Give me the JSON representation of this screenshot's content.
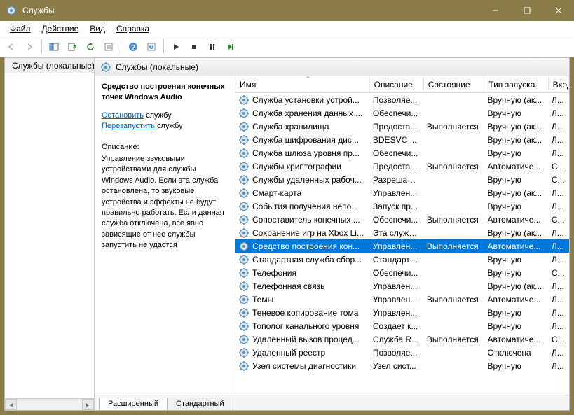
{
  "window": {
    "title": "Службы"
  },
  "menu": {
    "file": "Файл",
    "action": "Действие",
    "view": "Вид",
    "help": "Справка"
  },
  "tree": {
    "root": "Службы (локальные)"
  },
  "pane": {
    "header": "Службы (локальные)"
  },
  "detail": {
    "title": "Средство построения конечных точек Windows Audio",
    "stop_text": "Остановить",
    "stop_suffix": " службу",
    "restart_text": "Перезапустить",
    "restart_suffix": " службу",
    "desc_label": "Описание:",
    "desc": "Управление звуковыми устройствами для службы Windows Audio.  Если эта служба остановлена, то звуковые устройства и эффекты не будут правильно работать.  Если данная служба отключена, все явно зависящие от нее службы запустить не удастся"
  },
  "columns": {
    "name": "Имя",
    "desc": "Описание",
    "status": "Состояние",
    "startup": "Тип запуска",
    "logon": "Вход от имени"
  },
  "col_widths": {
    "name": 200,
    "desc": 80,
    "status": 90,
    "startup": 95,
    "logon": 30
  },
  "rows": [
    {
      "name": "Служба установки устрой...",
      "desc": "Позволяе...",
      "status": "",
      "startup": "Вручную (ак...",
      "logon": "Л..."
    },
    {
      "name": "Служба хранения данных ...",
      "desc": "Обеспечи...",
      "status": "",
      "startup": "Вручную",
      "logon": "Л..."
    },
    {
      "name": "Служба хранилища",
      "desc": "Предоста...",
      "status": "Выполняется",
      "startup": "Вручную (ак...",
      "logon": "Л..."
    },
    {
      "name": "Служба шифрования дис...",
      "desc": "BDESVC ...",
      "status": "",
      "startup": "Вручную (ак...",
      "logon": "Л..."
    },
    {
      "name": "Служба шлюза уровня пр...",
      "desc": "Обеспечи...",
      "status": "",
      "startup": "Вручную",
      "logon": "Л..."
    },
    {
      "name": "Службы криптографии",
      "desc": "Предоста...",
      "status": "Выполняется",
      "startup": "Автоматиче...",
      "logon": "С..."
    },
    {
      "name": "Службы удаленных рабоч...",
      "desc": "Разрешает...",
      "status": "",
      "startup": "Вручную",
      "logon": "С..."
    },
    {
      "name": "Смарт-карта",
      "desc": "Управлен...",
      "status": "",
      "startup": "Вручную (ак...",
      "logon": "Л..."
    },
    {
      "name": "События получения непо...",
      "desc": "Запуск пр...",
      "status": "",
      "startup": "Вручную",
      "logon": "Л..."
    },
    {
      "name": "Сопоставитель конечных ...",
      "desc": "Обеспечи...",
      "status": "Выполняется",
      "startup": "Автоматиче...",
      "logon": "С..."
    },
    {
      "name": "Сохранение игр на Xbox Li...",
      "desc": "Эта служб...",
      "status": "",
      "startup": "Вручную (ак...",
      "logon": "Л..."
    },
    {
      "name": "Средство построения кон...",
      "desc": "Управлен...",
      "status": "Выполняется",
      "startup": "Автоматиче...",
      "logon": "Л...",
      "selected": true
    },
    {
      "name": "Стандартная служба сбор...",
      "desc": "Стандартн...",
      "status": "",
      "startup": "Вручную",
      "logon": "Л..."
    },
    {
      "name": "Телефония",
      "desc": "Обеспечи...",
      "status": "",
      "startup": "Вручную",
      "logon": "С..."
    },
    {
      "name": "Телефонная связь",
      "desc": "Управлен...",
      "status": "",
      "startup": "Вручную (ак...",
      "logon": "Л..."
    },
    {
      "name": "Темы",
      "desc": "Управлен...",
      "status": "Выполняется",
      "startup": "Автоматиче...",
      "logon": "Л..."
    },
    {
      "name": "Теневое копирование тома",
      "desc": "Управлен...",
      "status": "",
      "startup": "Вручную",
      "logon": "Л..."
    },
    {
      "name": "Тополог канального уровня",
      "desc": "Создает к...",
      "status": "",
      "startup": "Вручную",
      "logon": "Л..."
    },
    {
      "name": "Удаленный вызов процед...",
      "desc": "Служба R...",
      "status": "Выполняется",
      "startup": "Автоматиче...",
      "logon": "С..."
    },
    {
      "name": "Удаленный реестр",
      "desc": "Позволяе...",
      "status": "",
      "startup": "Отключена",
      "logon": "Л..."
    },
    {
      "name": "Узел системы диагностики",
      "desc": "Узел сист...",
      "status": "",
      "startup": "Вручную",
      "logon": "Л..."
    }
  ],
  "tabs": {
    "ext": "Расширенный",
    "std": "Стандартный"
  }
}
